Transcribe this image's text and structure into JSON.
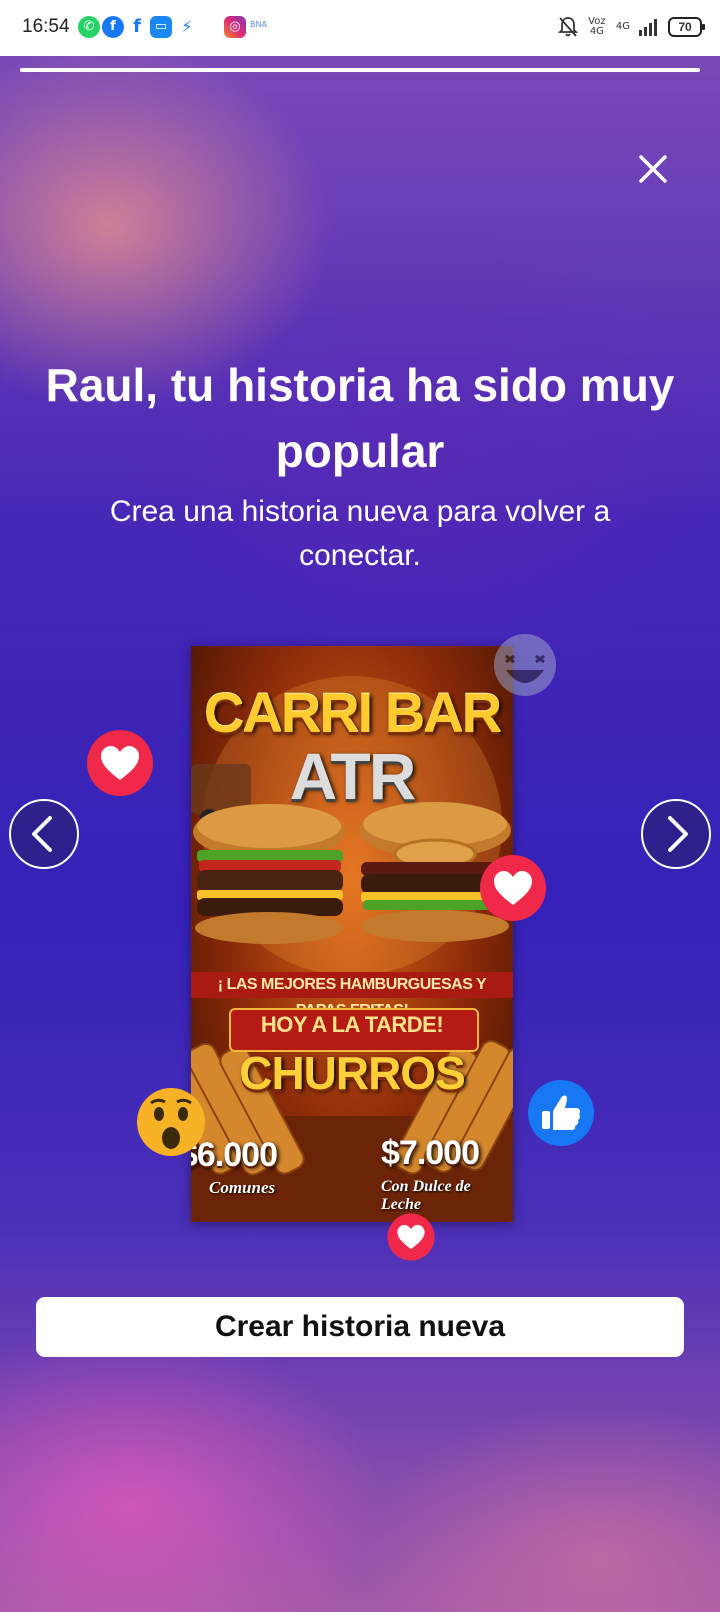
{
  "status_bar": {
    "time": "16:54",
    "notification_icons": [
      "whatsapp-icon",
      "facebook-icon",
      "facebook-f-icon",
      "chat-icon",
      "messenger-icon",
      "instagram-icon"
    ],
    "instagram_tag": "BNA",
    "network_label": "Voz 4G",
    "signal_label": "4G",
    "battery": "70"
  },
  "story": {
    "progress": 1.0,
    "headline": "Raul, tu historia ha sido muy popular",
    "subline": "Crea una historia nueva para volver a conectar.",
    "create_button_label": "Crear historia nueva"
  },
  "poster": {
    "title_line1": "CARRI BAR",
    "title_line2": "ATR",
    "banner": "¡ LAS MEJORES HAMBURGUESAS Y PAPAS FRITAS!",
    "subtitle": "HOY A LA TARDE!",
    "churros": "CHURROS",
    "price_left": "$6.000",
    "price_left_caption": "Comunes",
    "price_right": "$7.000",
    "price_right_caption": "Con Dulce de Leche"
  },
  "reactions": [
    "laugh-reaction-icon",
    "love-reaction-icon",
    "love-reaction-icon",
    "wow-reaction-icon",
    "like-reaction-icon",
    "love-reaction-icon"
  ],
  "colors": {
    "love": "#f0284a",
    "like": "#1877f2",
    "wow": "#f7b125",
    "background_top": "#7b4ab8",
    "background_mid": "#3522b8",
    "background_bottom": "#a35aa8"
  }
}
